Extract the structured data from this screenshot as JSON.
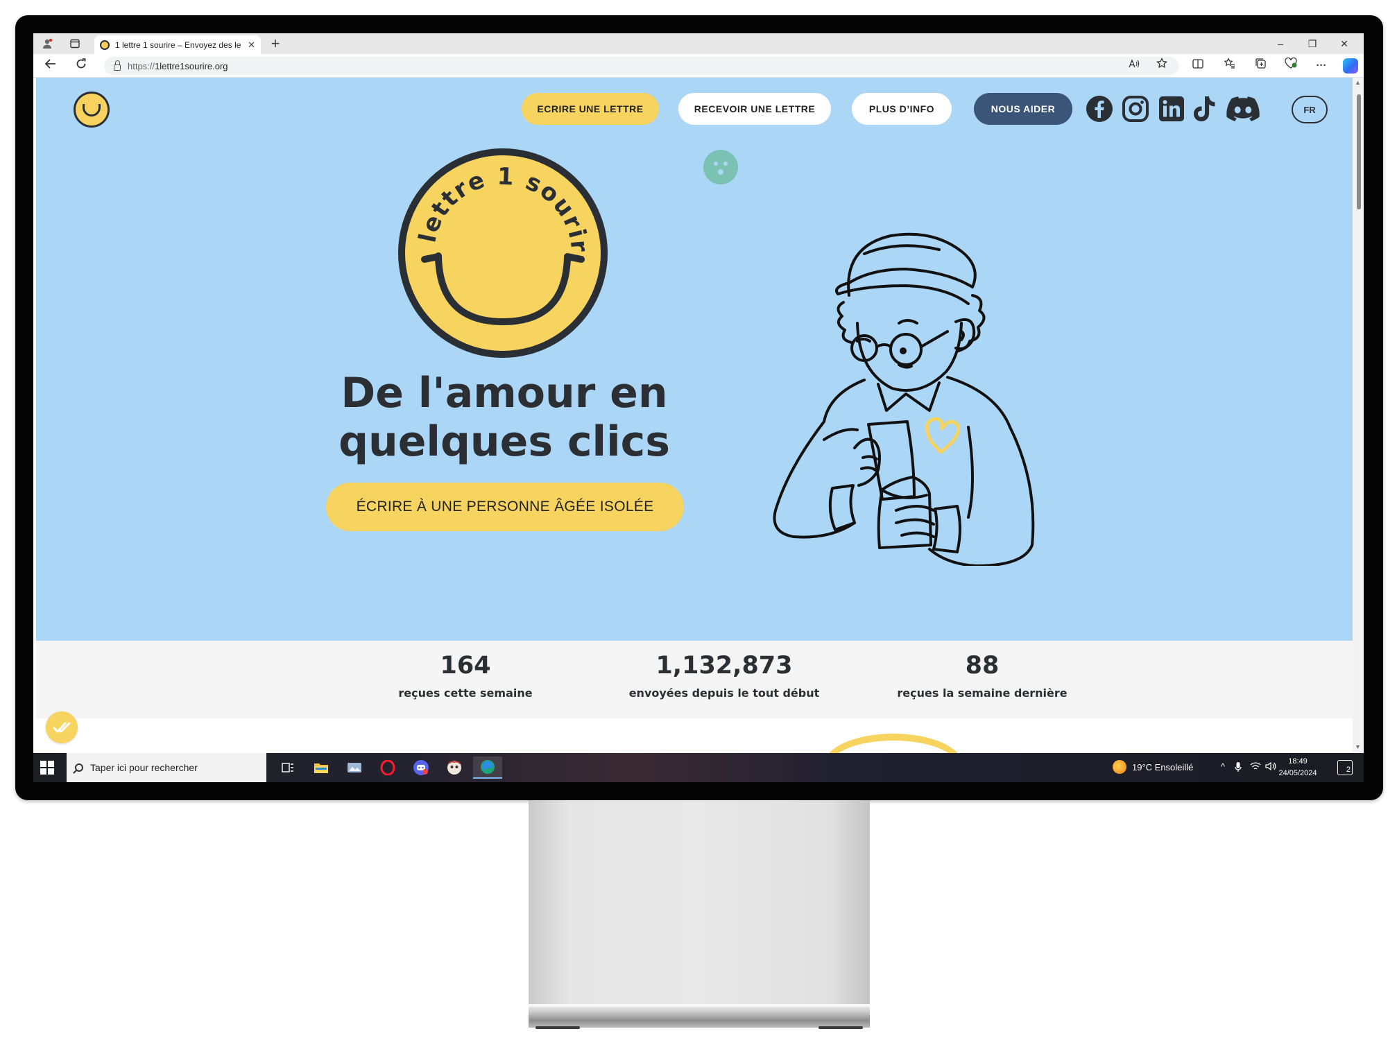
{
  "browser": {
    "tab_title": "1 lettre 1 sourire – Envoyez des le",
    "tab_close": "✕",
    "new_tab": "+",
    "url_prefix": "https://",
    "url_host": "1lettre1sourire.org",
    "window_controls": {
      "minimize": "–",
      "restore": "❐",
      "close": "✕"
    }
  },
  "site": {
    "nav": {
      "write": "ECRIRE UNE LETTRE",
      "receive": "RECEVOIR UNE LETTRE",
      "info": "PLUS D’INFO",
      "help": "NOUS AIDER"
    },
    "socials": [
      "facebook-icon",
      "instagram-icon",
      "linkedin-icon",
      "tiktok-icon",
      "discord-icon"
    ],
    "language": "FR",
    "hero": {
      "logo_text": "1 lettre 1 sourire",
      "title_line1": "De l'amour en",
      "title_line2": "quelques clics",
      "cta": "ÉCRIRE À UNE PERSONNE ÂGÉE ISOLÉE"
    },
    "stats": [
      {
        "value": "164",
        "label": "reçues cette semaine"
      },
      {
        "value": "1,132,873",
        "label": "envoyées depuis le tout début"
      },
      {
        "value": "88",
        "label": "reçues la semaine dernière"
      }
    ],
    "fab_icon": "double-check-icon"
  },
  "taskbar": {
    "search_placeholder": "Taper ici pour rechercher",
    "apps": [
      "task-view-icon",
      "file-explorer-icon",
      "photos-icon",
      "opera-icon",
      "discord-icon",
      "app-icon",
      "edge-icon"
    ],
    "weather": "19°C  Ensoleillé",
    "time": "18:49",
    "date": "24/05/2024",
    "notifications": "2"
  },
  "colors": {
    "hero_bg": "#acd6f6",
    "brand_yellow": "#f7d35f",
    "nav_help_bg": "#3b5578",
    "text_dark": "#2b2f33"
  }
}
